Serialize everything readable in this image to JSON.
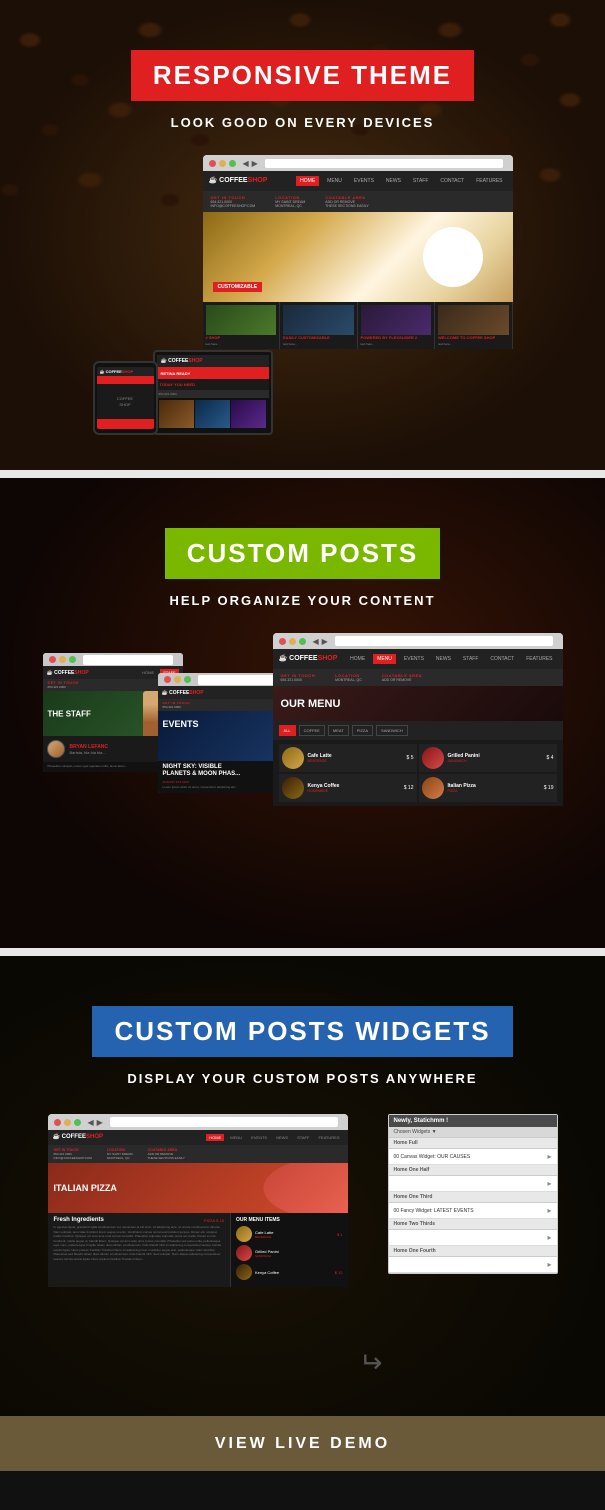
{
  "section1": {
    "badge": "RESPONSIVE THEME",
    "subtitle": "LOOK GOOD ON EVERY DEVICES",
    "nav_items": [
      "HOME",
      "MENU",
      "EVENTS",
      "NEWS",
      "STAFF",
      "CONTACT",
      "FEATURES"
    ],
    "logo_coffee": "COFFEE",
    "logo_shop": "SHOP",
    "info_blocks": [
      {
        "label": "GET IN TOUCH",
        "value": "654.321.0000\nINFO@COFFEESHOP.COM"
      },
      {
        "label": "LOCATION",
        "value": "MY SAINT DREAM\nMONTREAL, QC"
      },
      {
        "label": "COATABLE AREA",
        "value": "ADD OR REMOVE\nTHESE SECTIONS EASILY"
      }
    ],
    "customizable_badge": "CUSTOMIZABLE",
    "footer_cols": [
      "# SHOP",
      "EASILY CUSTOMIZABLE",
      "POWERED BY FLEXSLIDER 2",
      "WELCOME TO COFFEE SHOP"
    ]
  },
  "section2": {
    "badge": "CUSTOM POSTS",
    "subtitle": "HELP ORGANIZE YOUR CONTENT",
    "staff_title": "THE STAFF",
    "events_title": "EVENTS",
    "events_subtitle": "NIGHT SKY: VISIBLE PLANETS & MOON PHASE...",
    "person_name": "BRYAN LEFANC",
    "menu_filters": [
      "ALL",
      "COFFEE",
      "MEAT",
      "PIZZA",
      "SANDWICH"
    ],
    "menu_title": "OUR MENU",
    "menu_items": [
      {
        "name": "Cafe Latte",
        "cat": "BEVERAGE",
        "price": "$ 5"
      },
      {
        "name": "Grilled Panini",
        "cat": "SANDWICH",
        "price": "$ 4"
      },
      {
        "name": "Kenya Coffee",
        "cat": "HOMEMADE",
        "price": "$ 12"
      },
      {
        "name": "Italian Pizza",
        "cat": "PIZZA",
        "price": "$ 19"
      }
    ]
  },
  "section3": {
    "badge": "CUSTOM POSTS WIDGETS",
    "subtitle": "DISPLAY YOUR CUSTOM POSTS ANYWHERE",
    "pizza_title": "ITALIAN PIZZA",
    "fresh_title": "Fresh Ingredients",
    "fresh_price": "PIZZA  $ 18",
    "our_menu_title": "OUR MENU ITEMS",
    "menu_items": [
      {
        "name": "Cafe Latte",
        "cat": "BEVERAGE",
        "price": "$ 1"
      },
      {
        "name": "Grilled Panini",
        "cat": "SANDWICH",
        "price": ""
      },
      {
        "name": "Kenya Coffee",
        "cat": "",
        "price": "$ 12"
      }
    ],
    "widget_title": "Newly, Statichmm !",
    "widget_sections": [
      {
        "label": "Home Full",
        "select": "00 Canvas Widget: OUR CAUSES"
      },
      {
        "label": "Home One Half",
        "select": ""
      },
      {
        "label": "Home One Third",
        "select": "00 Fancy Widget: LATEST EVENTS"
      },
      {
        "label": "Home Two Thirds",
        "select": ""
      },
      {
        "label": "Home One Fourth",
        "select": ""
      }
    ]
  },
  "bottom_bar": {
    "button_label": "VIEW LIVE DEMO"
  }
}
